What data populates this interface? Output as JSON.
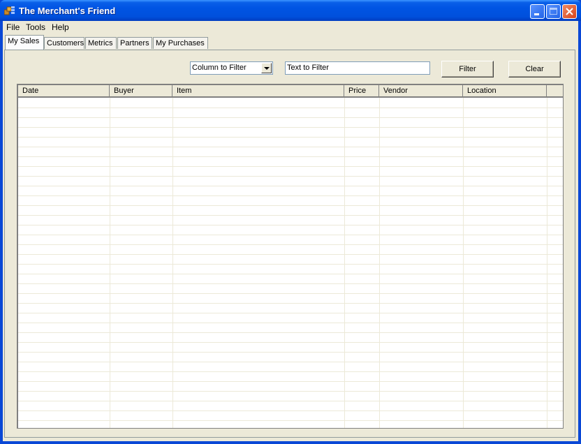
{
  "window": {
    "title": "The Merchant's Friend",
    "controls": [
      "minimize",
      "maximize",
      "close"
    ]
  },
  "menu": {
    "items": [
      {
        "label": "File"
      },
      {
        "label": "Tools"
      },
      {
        "label": "Help"
      }
    ]
  },
  "tabs": [
    {
      "label": "My Sales",
      "active": true
    },
    {
      "label": "Customers",
      "active": false
    },
    {
      "label": "Metrics",
      "active": false
    },
    {
      "label": "Partners",
      "active": false
    },
    {
      "label": "My Purchases",
      "active": false
    }
  ],
  "filter": {
    "column_select_value": "Column to Filter",
    "text_value": "Text to Filter",
    "filter_button": "Filter",
    "clear_button": "Clear"
  },
  "grid": {
    "columns": [
      "Date",
      "Buyer",
      "Item",
      "Price",
      "Vendor",
      "Location",
      ""
    ],
    "rows": []
  }
}
